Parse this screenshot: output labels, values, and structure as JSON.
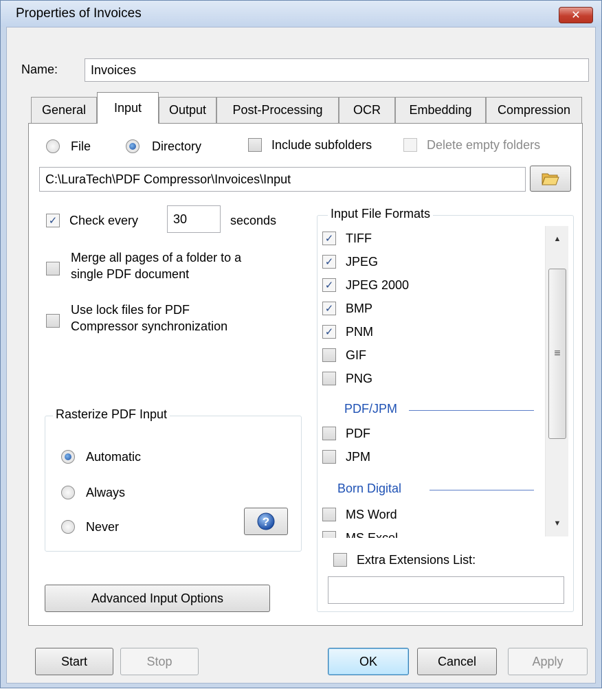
{
  "window": {
    "title": "Properties of Invoices",
    "close_label": "✕"
  },
  "name_field": {
    "label": "Name:",
    "value": "Invoices"
  },
  "tabs": [
    {
      "label": "General",
      "active": false
    },
    {
      "label": "Input",
      "active": true
    },
    {
      "label": "Output",
      "active": false
    },
    {
      "label": "Post-Processing",
      "active": false
    },
    {
      "label": "OCR",
      "active": false
    },
    {
      "label": "Embedding",
      "active": false
    },
    {
      "label": "Compression",
      "active": false
    }
  ],
  "source": {
    "file_label": "File",
    "directory_label": "Directory",
    "selected": "Directory",
    "include_subfolders": {
      "label": "Include subfolders",
      "checked": false
    },
    "delete_empty_folders": {
      "label": "Delete empty folders",
      "checked": false,
      "enabled": false
    }
  },
  "path": {
    "value": "C:\\LuraTech\\PDF Compressor\\Invoices\\Input",
    "browse_icon": "folder-open-icon"
  },
  "check_every": {
    "checked": true,
    "label": "Check every",
    "value": "30",
    "unit": "seconds"
  },
  "merge_pages": {
    "checked": false,
    "label_line1": "Merge all pages of a folder to a",
    "label_line2": "single PDF document"
  },
  "lock_files": {
    "checked": false,
    "label_line1": "Use lock files for PDF",
    "label_line2": "Compressor synchronization"
  },
  "rasterize": {
    "title": "Rasterize PDF Input",
    "options": [
      "Automatic",
      "Always",
      "Never"
    ],
    "selected": "Automatic",
    "help_icon": "question-mark-icon"
  },
  "advanced_button": "Advanced Input Options",
  "formats": {
    "title": "Input File Formats",
    "images": [
      {
        "label": "TIFF",
        "checked": true
      },
      {
        "label": "JPEG",
        "checked": true
      },
      {
        "label": "JPEG 2000",
        "checked": true
      },
      {
        "label": "BMP",
        "checked": true
      },
      {
        "label": "PNM",
        "checked": true
      },
      {
        "label": "GIF",
        "checked": false
      },
      {
        "label": "PNG",
        "checked": false
      }
    ],
    "pdf_section": "PDF/JPM",
    "pdf": [
      {
        "label": "PDF",
        "checked": false
      },
      {
        "label": "JPM",
        "checked": false
      }
    ],
    "born_section": "Born Digital",
    "born": [
      {
        "label": "MS Word",
        "checked": false
      },
      {
        "label": "MS Excel",
        "checked": false
      }
    ],
    "extra_extensions": {
      "label": "Extra Extensions List:",
      "checked": false,
      "value": ""
    }
  },
  "bottom_buttons": {
    "start": "Start",
    "stop": "Stop",
    "ok": "OK",
    "cancel": "Cancel",
    "apply": "Apply"
  },
  "check_mark": "✓"
}
